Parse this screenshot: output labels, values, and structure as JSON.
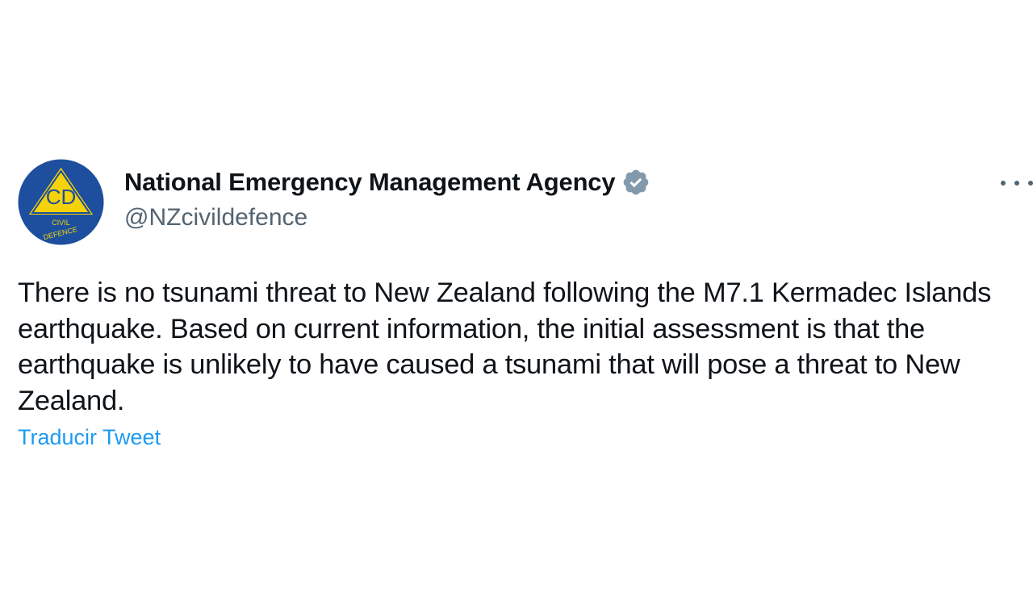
{
  "author": {
    "display_name": "National Emergency Management Agency",
    "handle": "@NZcivildefence",
    "verified": true,
    "avatar": {
      "logo_text": "CD",
      "ring_text_top": "CIVIL",
      "ring_text_bottom": "DEFENCE",
      "colors": {
        "circle": "#1d4f9e",
        "triangle": "#f5d20a",
        "triangle_stroke": "#1d4f9e"
      }
    }
  },
  "tweet": {
    "text": "There is no tsunami threat to New Zealand following the M7.1 Kermadec Islands earthquake. Based on current information, the initial assessment is that the earthquake is unlikely to have caused a tsunami that will pose a threat to New Zealand.",
    "translate_label": "Traducir Tweet"
  },
  "icons": {
    "verified": "verified-badge-icon",
    "more": "more-options-icon"
  },
  "colors": {
    "text": "#0f1419",
    "secondary": "#536471",
    "link": "#1d9bf0",
    "verified_badge": "#829aab"
  }
}
